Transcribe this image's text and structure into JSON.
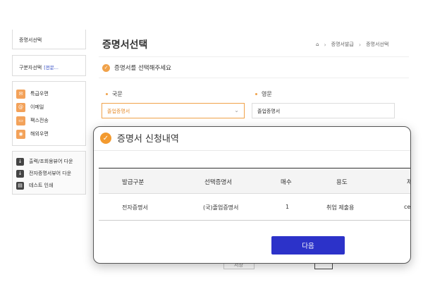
{
  "sidebar": {
    "cert_select": "증명서선택",
    "gubun_label": "구분자선택",
    "gubun_value": "[전문...",
    "delivery": [
      {
        "label": "특급우편",
        "icon": "mail-icon"
      },
      {
        "label": "이메일",
        "icon": "at-icon"
      },
      {
        "label": "팩스전송",
        "icon": "fax-icon"
      },
      {
        "label": "해외우편",
        "icon": "globe-mail-icon"
      }
    ],
    "downloads": [
      {
        "label": "출력/조회용뷰어 다운",
        "icon": "download-icon"
      },
      {
        "label": "전자증명서뷰어 다운",
        "icon": "download-icon"
      },
      {
        "label": "테스트 인쇄",
        "icon": "printer-icon"
      }
    ]
  },
  "main": {
    "title": "증명서선택",
    "breadcrumb": [
      "증명서발급",
      "증명서선택"
    ],
    "notice": "증명서를 선택해주세요",
    "korean_label": "국문",
    "english_label": "영문",
    "korean_select_value": "졸업증명서",
    "english_value": "졸업증명서",
    "bg_button": "저장"
  },
  "modal": {
    "title": "증명서 신청내역",
    "columns": [
      "발급구분",
      "선택증명서",
      "매수",
      "용도",
      "제"
    ],
    "rows": [
      [
        "전자증명서",
        "(국)졸업증명서",
        "1",
        "취업 제출용",
        "ce"
      ]
    ],
    "next_button": "다음"
  },
  "colors": {
    "accent_orange": "#f39a2f",
    "primary_blue": "#2c32c9"
  }
}
